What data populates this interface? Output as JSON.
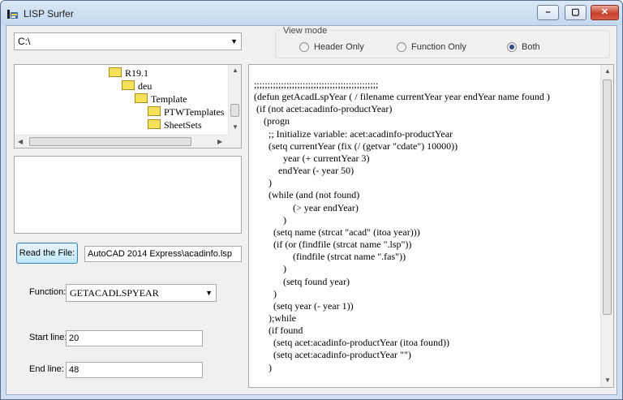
{
  "window": {
    "title": "LISP Surfer"
  },
  "path_combo": {
    "value": "C:\\"
  },
  "view_mode": {
    "title": "View mode",
    "options": [
      {
        "label": "Header Only",
        "selected": false
      },
      {
        "label": "Function Only",
        "selected": false
      },
      {
        "label": "Both",
        "selected": true
      }
    ]
  },
  "tree": {
    "items": [
      "R19.1",
      "deu",
      "Template",
      "PTWTemplates",
      "SheetSets"
    ]
  },
  "read_button": {
    "label": "Read the File:"
  },
  "file_path": {
    "value": "AutoCAD 2014 Express\\acadinfo.lsp"
  },
  "function": {
    "label": "Function:",
    "value": "GETACADLSPYEAR"
  },
  "start_line": {
    "label": "Start line:",
    "value": "20"
  },
  "end_line": {
    "label": "End line:",
    "value": "48"
  },
  "code": {
    "text": ";;;;;;;;;;;;;;;;;;;;;;;;;;;;;;;;;;;;;;;;;;;;;;\n(defun getAcadLspYear ( / filename currentYear year endYear name found )\n (if (not acet:acadinfo-productYear)\n    (progn\n      ;; Initialize variable: acet:acadinfo-productYear\n      (setq currentYear (fix (/ (getvar \"cdate\") 10000))\n            year (+ currentYear 3)\n          endYear (- year 50)\n      )\n      (while (and (not found)\n                (> year endYear)\n            )\n        (setq name (strcat \"acad\" (itoa year)))\n        (if (or (findfile (strcat name \".lsp\"))\n                (findfile (strcat name \".fas\"))\n            )\n            (setq found year)\n        )\n        (setq year (- year 1))\n      );while\n      (if found\n        (setq acet:acadinfo-productYear (itoa found))\n        (setq acet:acadinfo-productYear \"\")\n      )"
  }
}
